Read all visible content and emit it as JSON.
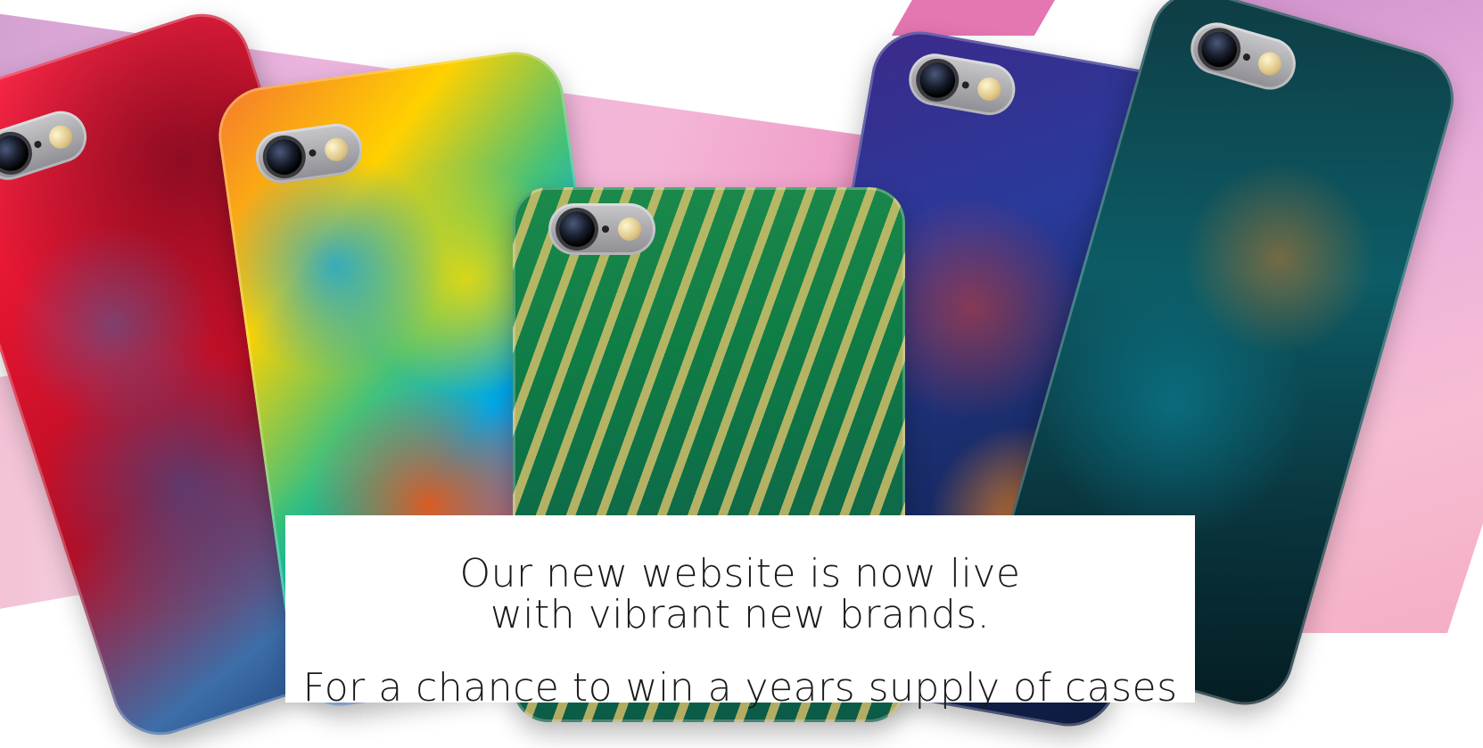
{
  "promo": {
    "line1": "Our new website is now live",
    "line2": "with vibrant new brands.",
    "line3": "For a chance to win a years supply of cases"
  },
  "colors": {
    "background": "#ffffff",
    "text": "#1a1a1a",
    "accent_pink": "#e979b5",
    "accent_purple": "#c98fc8"
  },
  "icons": {
    "camera": "camera-icon",
    "lens": "lens-icon",
    "flash": "flash-icon"
  }
}
